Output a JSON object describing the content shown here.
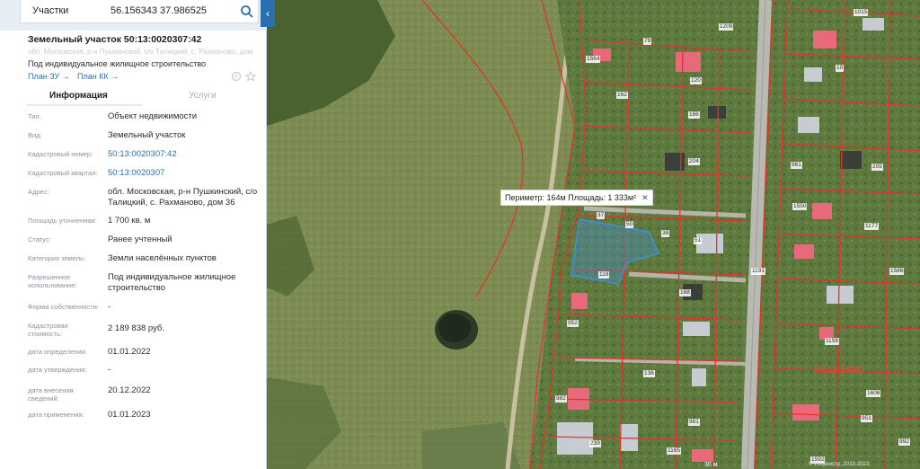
{
  "search": {
    "mode_label": "Участки",
    "query": "56.156343 37.986525",
    "collapse_glyph": "‹"
  },
  "parcel": {
    "title": "Земельный участок 50:13:0020307:42",
    "address_faded": "обл. Московская, р-н Пушкинский, с/о Талицкий, с. Рахманово, дом 36",
    "use": "Под индивидуальное жилищное строительство",
    "plan_zu": "План ЗУ",
    "plan_kk": "План КК"
  },
  "tabs": {
    "info": "Информация",
    "services": "Услуги"
  },
  "info_rows": [
    {
      "label": "Тип:",
      "value": "Объект недвижимости"
    },
    {
      "label": "Вид:",
      "value": "Земельный участок"
    },
    {
      "label": "Кадастровый номер:",
      "value": "50:13:0020307:42"
    },
    {
      "label": "Кадастровый квартал:",
      "value": "50:13:0020307"
    },
    {
      "label": "Адрес:",
      "value": "обл. Московская, р-н Пушкинский, с/о Талицкий, с. Рахманово, дом 36"
    },
    {
      "label": "Площадь уточненная:",
      "value": "1 700 кв. м"
    },
    {
      "label": "Статус:",
      "value": "Ранее учтенный"
    },
    {
      "label": "Категория земель:",
      "value": "Земли населённых пунктов"
    },
    {
      "label": "Разрешенное использование:",
      "value": "Под индивидуальное жилищное строительство"
    },
    {
      "label": "Форма собственности:",
      "value": "-"
    },
    {
      "label": "Кадастровая стоимость:",
      "value": "2 189 838 руб."
    },
    {
      "label": "дата определения:",
      "value": "01.01.2022"
    },
    {
      "label": "дата утверждения:",
      "value": "-"
    },
    {
      "label": "дата внесения сведений:",
      "value": "20.12.2022"
    },
    {
      "label": "дата применения:",
      "value": "01.01.2023"
    }
  ],
  "map": {
    "popup_text": "Периметр: 164м Площадь: 1 333м²",
    "popup_close": "✕",
    "quarter_label": "50:13:20307",
    "scale_label": "30 м",
    "attribution": "© Росреестр, 2010-2023",
    "plot_numbers": [
      "1015",
      "1209",
      "79",
      "1564",
      "120",
      "162",
      "166",
      "10",
      "204",
      "961",
      "205",
      "37",
      "50",
      "38",
      "51",
      "1550",
      "1177",
      "118",
      "168",
      "1191",
      "1586",
      "952",
      "1158",
      "136",
      "982",
      "1606",
      "981",
      "951",
      "239",
      "1165",
      "1592",
      "992"
    ]
  },
  "colors": {
    "accent": "#2a6fb0",
    "boundary": "#e0352b",
    "selected": "#3f8fe0"
  }
}
